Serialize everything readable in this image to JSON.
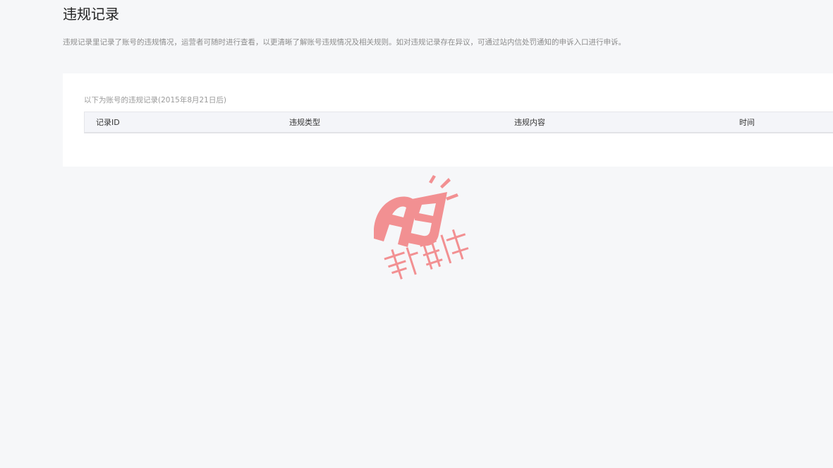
{
  "page": {
    "title": "违规记录",
    "description": "违规记录里记录了账号的违规情况，运营者可随时进行查看，以更清晰了解账号违规情况及相关规则。如对违规记录存在异议，可通过站内信处罚通知的申诉入口进行申诉。"
  },
  "records_panel": {
    "caption": "以下为账号的违规记录(2015年8月21日后)",
    "columns": [
      "记录ID",
      "违规类型",
      "违规内容",
      "时间"
    ],
    "rows": []
  },
  "watermark": {
    "logo_text": "A5",
    "tagline": "新媒体",
    "color": "#f28b8d"
  }
}
